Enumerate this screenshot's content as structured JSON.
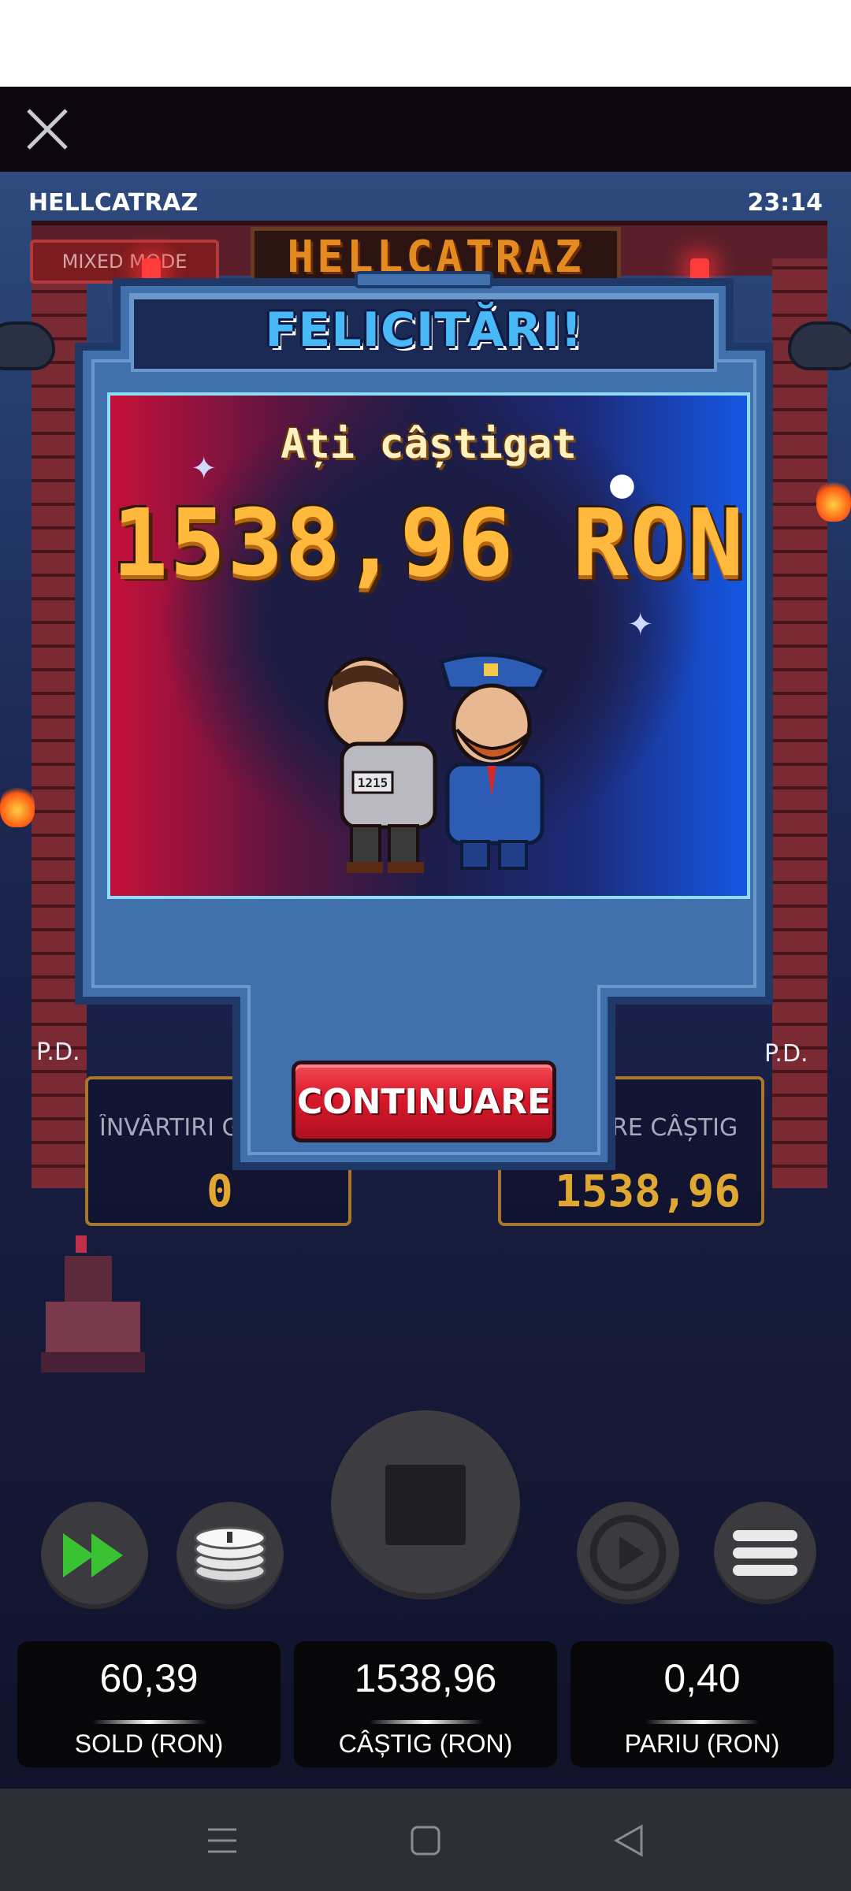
{
  "header": {
    "close_icon": "close-icon"
  },
  "game": {
    "title": "HELLCATRAZ",
    "clock": "23:14",
    "logo_text": "HELLCATRAZ",
    "mode_badge": "MIXED MODE",
    "boat_left_label": "P.D.",
    "boat_right_label": "P.D."
  },
  "info_boxes": {
    "free_spins_label": "ÎNVÂRTIRI G",
    "free_spins_value": "0",
    "win_label": "RE CÂȘTIG",
    "win_value": "1538,96"
  },
  "modal": {
    "title": "FELICITĂRI!",
    "subtitle": "Ați câștigat",
    "amount": "1538,96 RON",
    "prisoner_number": "1215",
    "continue_label": "CONTINUARE"
  },
  "controls": {
    "fast_forward_icon": "fast-forward-icon",
    "coins_icon": "coins-icon",
    "stop_icon": "stop-icon",
    "autoplay_icon": "autoplay-icon",
    "menu_icon": "menu-icon"
  },
  "stats": [
    {
      "value": "60,39",
      "label": "SOLD (RON)"
    },
    {
      "value": "1538,96",
      "label": "CÂȘTIG (RON)"
    },
    {
      "value": "0,40",
      "label": "PARIU (RON)"
    }
  ],
  "colors": {
    "accent_title": "#48b8f6",
    "amount": "#ffb93c",
    "continue_button": "#d8192a",
    "fast_forward": "#39c232"
  }
}
